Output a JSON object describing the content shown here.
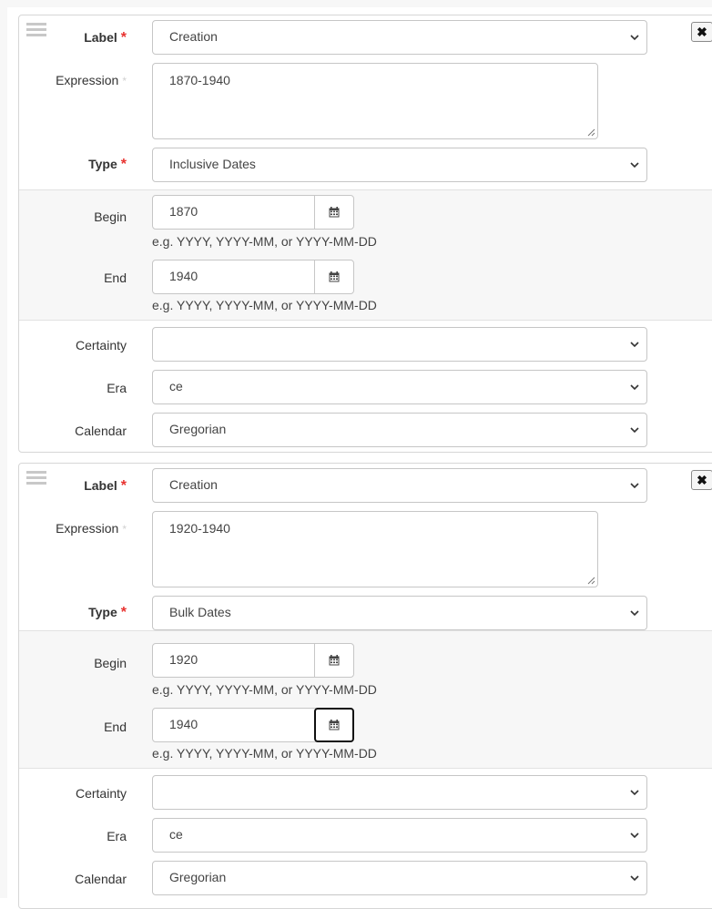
{
  "labels": {
    "label": "Label",
    "expression": "Expression",
    "type": "Type",
    "begin": "Begin",
    "end": "End",
    "certainty": "Certainty",
    "era": "Era",
    "calendar": "Calendar",
    "required_mark": "*",
    "optional_mark": "*"
  },
  "hint": "e.g. YYYY, YYYY-MM, or YYYY-MM-DD",
  "remove_glyph": "✖",
  "icons": {
    "drag": "drag-handle-icon",
    "calendar": "calendar-icon",
    "dropdown": "chevron-down-icon",
    "remove": "close-icon",
    "resize": "resize-grip-icon"
  },
  "colors": {
    "required": "#e8322f",
    "section_bg": "#f7f7f7",
    "border": "#c6c6c6"
  },
  "dates": [
    {
      "label_value": "Creation",
      "expression": "1870-1940",
      "type": "Inclusive Dates",
      "begin": "1870",
      "end": "1940",
      "certainty": "",
      "era": "ce",
      "calendar": "Gregorian"
    },
    {
      "label_value": "Creation",
      "expression": "1920-1940",
      "type": "Bulk Dates",
      "begin": "1920",
      "end": "1940",
      "certainty": "",
      "era": "ce",
      "calendar": "Gregorian"
    }
  ]
}
